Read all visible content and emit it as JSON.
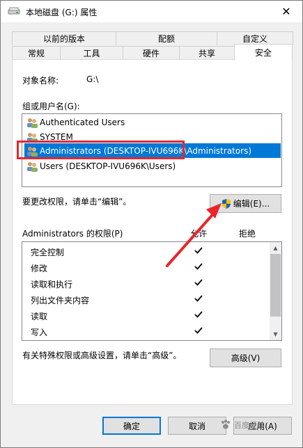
{
  "window": {
    "title": "本地磁盘 (G:) 属性"
  },
  "tabs_top": [
    "以前的版本",
    "配额",
    "自定义"
  ],
  "tabs_bottom": [
    "常规",
    "工具",
    "硬件",
    "共享",
    "安全"
  ],
  "object_label": "对象名称:",
  "object_value": "G:\\",
  "group_label": "组或用户名(G):",
  "users": [
    "Authenticated Users",
    "SYSTEM",
    "Administrators (DESKTOP-IVU696K\\Administrators)",
    "Users (DESKTOP-IVU696K\\Users)"
  ],
  "selected_user_index": 2,
  "change_hint": "要更改权限，请单击“编辑”。",
  "edit_button": "编辑(E)...",
  "perm_title": "Administrators 的权限(P)",
  "allow_header": "允许",
  "deny_header": "拒绝",
  "permissions": [
    {
      "name": "完全控制",
      "allow": true,
      "deny": false
    },
    {
      "name": "修改",
      "allow": true,
      "deny": false
    },
    {
      "name": "读取和执行",
      "allow": true,
      "deny": false
    },
    {
      "name": "列出文件夹内容",
      "allow": true,
      "deny": false
    },
    {
      "name": "读取",
      "allow": true,
      "deny": false
    },
    {
      "name": "写入",
      "allow": true,
      "deny": false
    }
  ],
  "advanced_hint": "有关特殊权限或高级设置，请单击“高级”。",
  "advanced_button": "高级(V)",
  "ok_button": "确定",
  "cancel_button": "取消",
  "apply_button": "应用(A)",
  "watermark_text": "百度经验",
  "colors": {
    "accent": "#0078d7",
    "highlight": "#e8262b"
  }
}
